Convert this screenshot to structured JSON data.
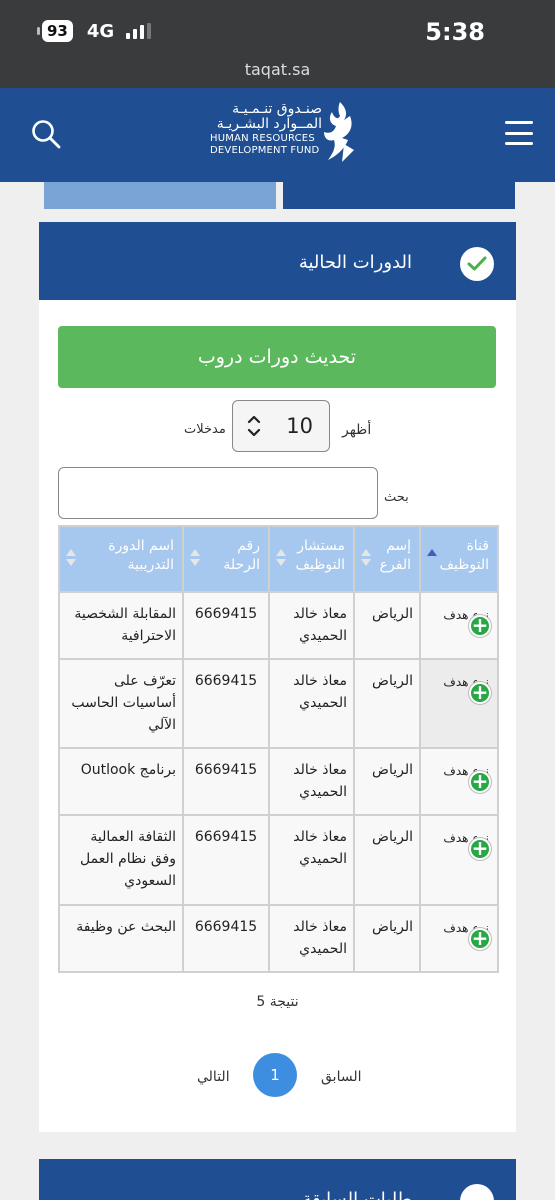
{
  "status_bar": {
    "battery": "93",
    "network": "4G",
    "time": "5:38",
    "url": "taqat.sa"
  },
  "header": {
    "logo_ar_line1": "صنـدوق تنـمـيـة",
    "logo_ar_line2": "المــوارد البشـريـة",
    "logo_en_line1": "HUMAN RESOURCES",
    "logo_en_line2": "DEVELOPMENT FUND",
    "icons": [
      "search-icon",
      "menu-icon"
    ]
  },
  "section": {
    "title": "الدورات الحالية",
    "refresh_label": "تحديث دورات دروب",
    "show_label": "أظهر",
    "entries_value": "10",
    "entries_label": "مدخلات",
    "search_label": "بحث",
    "search_value": ""
  },
  "table": {
    "columns": [
      "قناة التوظيف",
      "إسم الفرع",
      "مستشار التوظيف",
      "رقم الرحلة",
      "اسم الدورة التدريبية"
    ],
    "rows": [
      {
        "type": "نوع هدف",
        "branch": "الرياض",
        "consultant": "معاذ خالد الحميدي",
        "trip": "6669415",
        "course": "المقابلة الشخصية الاحترافية"
      },
      {
        "type": "نوع هدف",
        "branch": "الرياض",
        "consultant": "معاذ خالد الحميدي",
        "trip": "6669415",
        "course": "تعرّف على أساسيات الحاسب الآلي"
      },
      {
        "type": "نوع هدف",
        "branch": "الرياض",
        "consultant": "معاذ خالد الحميدي",
        "trip": "6669415",
        "course": "برنامج Outlook"
      },
      {
        "type": "نوع هدف",
        "branch": "الرياض",
        "consultant": "معاذ خالد الحميدي",
        "trip": "6669415",
        "course": "الثقافة العمالية وفق نظام العمل السعودي"
      },
      {
        "type": "نوع هدف",
        "branch": "الرياض",
        "consultant": "معاذ خالد الحميدي",
        "trip": "6669415",
        "course": "البحث عن وظيفة"
      }
    ]
  },
  "pagination": {
    "results": "5 نتيجة",
    "prev": "السابق",
    "current": "1",
    "next": "التالي"
  },
  "section2": {
    "title": "طلبات السابقة"
  },
  "colors": {
    "brand": "#1f4f92",
    "tab_light": "#7aa3d6",
    "button_green": "#5cb85c",
    "table_header": "#a6c8ef",
    "pager": "#3d8de0",
    "add_icon": "#28a745"
  }
}
